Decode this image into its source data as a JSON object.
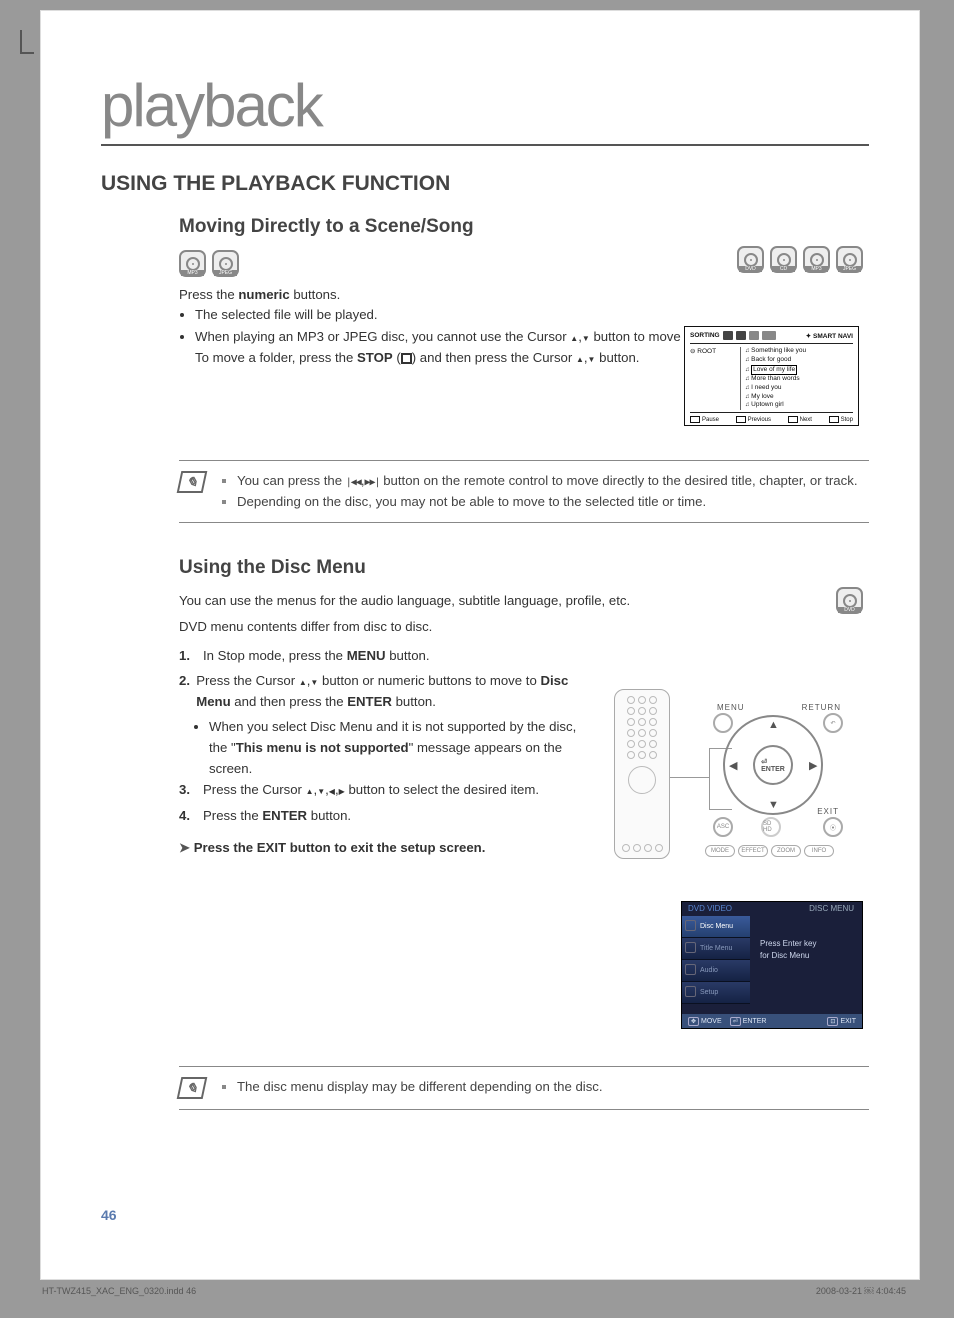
{
  "header": {
    "chapter": "playback"
  },
  "section_title": "USING THE PLAYBACK FUNCTION",
  "disc_labels": {
    "dvd": "DVD",
    "cd": "CD",
    "mp3": "MP3",
    "jpeg": "JPEG"
  },
  "scene": {
    "title": "Moving Directly to a Scene/Song",
    "intro_pre": "Press the ",
    "intro_bold": "numeric",
    "intro_post": " buttons.",
    "b1": "The selected file will be played.",
    "b2a": "When playing an MP3 or JPEG disc, you cannot use the Cursor ",
    "b2b": " button to move to a folder.",
    "b2c_pre": "To move a folder, press the ",
    "b2c_bold": "STOP",
    "b2c_mid": " (",
    "b2c_post": ") and then press the Cursor ",
    "b2c_end": " button.",
    "note1a": "You can press the ",
    "note1b": " button on the remote control to move directly to the desired title, chapter, or track.",
    "note2": "Depending on the disc, you may not be able to move to the selected title or time."
  },
  "sortbox": {
    "sorting": "SORTING",
    "smart": "SMART NAVI",
    "root": "ROOT",
    "files": [
      "Something like you",
      "Back for good",
      "Love of my life",
      "More than words",
      "I need you",
      "My love",
      "Uptown girl"
    ],
    "controls": {
      "pause": "Pause",
      "prev": "Previous",
      "next": "Next",
      "stop": "Stop"
    }
  },
  "discmenu": {
    "title": "Using the Disc Menu",
    "p1": "You can use the menus for the audio language, subtitle language, profile, etc.",
    "p2": "DVD menu contents differ from disc to disc.",
    "s1_pre": "In Stop mode, press the ",
    "s1_bold": "MENU",
    "s1_post": " button.",
    "s2_pre": "Press the Cursor ",
    "s2_mid": " button or numeric buttons to move to ",
    "s2_bold": "Disc Menu",
    "s2_post": " and then press the ",
    "s2_bold2": "ENTER",
    "s2_end": " button.",
    "s2_sub_pre": "When you select Disc Menu and it is not supported by the disc, the \"",
    "s2_sub_bold": "This menu is not supported",
    "s2_sub_post": "\" message appears on the screen.",
    "s3_pre": "Press the Cursor ",
    "s3_post": " button to select the desired item.",
    "s4_pre": "Press the ",
    "s4_bold": "ENTER",
    "s4_post": " button.",
    "tip": "Press the EXIT button to exit the setup screen.",
    "note": "The disc menu display may be different depending on the disc."
  },
  "remote": {
    "menu": "MENU",
    "return": "RETURN",
    "enter": "ENTER",
    "exit": "EXIT",
    "asc": "ASC",
    "sd": "SD HD",
    "pills": [
      "MODE",
      "EFFECT",
      "ZOOM",
      "INFO"
    ]
  },
  "menufig": {
    "hdr": "DVD VIDEO",
    "hdr2": "DISC MENU",
    "tabs": [
      "Disc Menu",
      "Title Menu",
      "Audio",
      "Setup"
    ],
    "msg1": "Press Enter key",
    "msg2": "for Disc Menu",
    "move": "MOVE",
    "enter": "ENTER",
    "exit": "EXIT"
  },
  "page_number": "46",
  "footer_left": "HT-TWZ415_XAC_ENG_0320.indd   46",
  "footer_right": "2008-03-21   ￼ 4:04:45"
}
